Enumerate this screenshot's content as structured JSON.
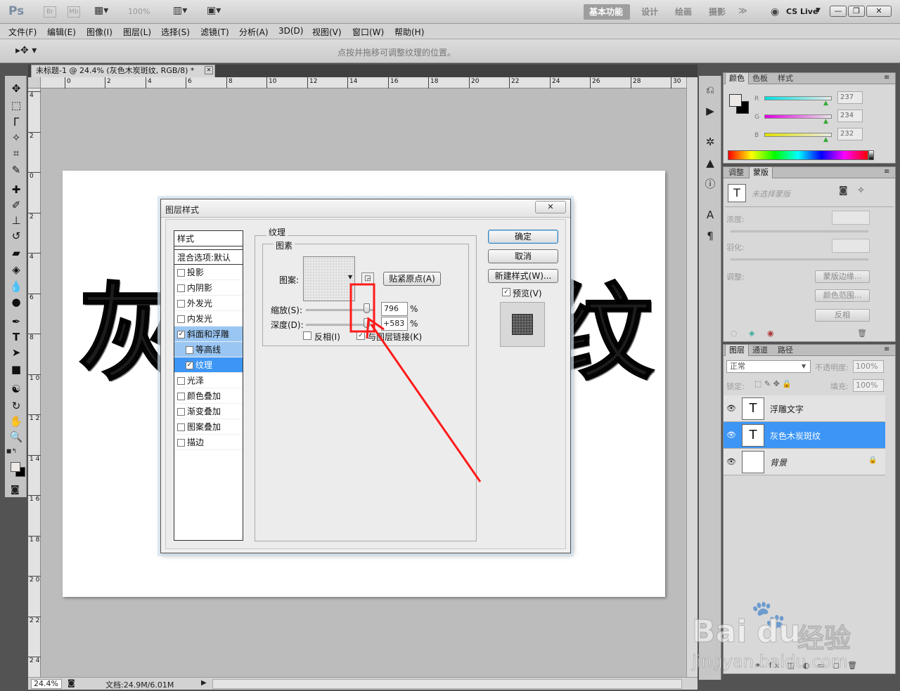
{
  "app": {
    "logo": "Ps",
    "mini_br": "Br",
    "mini_mb": "Mb",
    "zoom": "100%",
    "workspaces": [
      "基本功能",
      "设计",
      "绘画",
      "摄影"
    ],
    "more": "≫",
    "cslive": "CS Live",
    "win_min": "—",
    "win_max": "❐",
    "win_close": "✕"
  },
  "menu": [
    "文件(F)",
    "编辑(E)",
    "图像(I)",
    "图层(L)",
    "选择(S)",
    "滤镜(T)",
    "分析(A)",
    "3D(D)",
    "视图(V)",
    "窗口(W)",
    "帮助(H)"
  ],
  "options_hint": "点按并拖移可调整纹理的位置。",
  "document": {
    "tab_title": "未标题-1 @ 24.4% (灰色木炭斑纹, RGB/8) *",
    "tab_close": "✕",
    "canvas_char_left": "灰",
    "canvas_char_right": "纹",
    "ruler_top": [
      "0",
      "2",
      "4",
      "6",
      "8",
      "10",
      "12",
      "14",
      "16",
      "18",
      "20",
      "22",
      "24",
      "26",
      "28",
      "30"
    ],
    "ruler_left": [
      "4",
      "2",
      "0",
      "2",
      "4",
      "6",
      "8",
      "1 0",
      "1 2",
      "1 4",
      "1 6",
      "1 8",
      "2 0",
      "2 2",
      "2 4"
    ]
  },
  "status": {
    "zoom": "24.4%",
    "doc": "文档:24.9M/6.01M"
  },
  "color_panel": {
    "tabs": [
      "颜色",
      "色板",
      "样式"
    ],
    "r_label": "R",
    "g_label": "G",
    "b_label": "B",
    "r": 237,
    "g": 234,
    "b": 232
  },
  "masks_panel": {
    "tabs": [
      "调整",
      "蒙版"
    ],
    "no_mask": "未选择蒙版",
    "density": "浓度:",
    "feather": "羽化:",
    "refine": "调整:",
    "btn_edge": "蒙版边缘...",
    "btn_range": "颜色范围...",
    "btn_invert": "反相"
  },
  "layers_panel": {
    "tabs": [
      "图层",
      "通道",
      "路径"
    ],
    "blend": "正常",
    "opacity_label": "不透明度:",
    "opacity": "100%",
    "lock_label": "锁定:",
    "fill_label": "填充:",
    "fill": "100%",
    "layers": [
      {
        "name": "浮雕文字",
        "thumb": "T",
        "selected": false
      },
      {
        "name": "灰色木炭斑纹",
        "thumb": "T",
        "selected": true
      },
      {
        "name": "背景",
        "thumb": "",
        "selected": false
      }
    ],
    "footer_icons": "⚭ fx ◫ ◐ ▭ ◻ 🗑"
  },
  "dialog": {
    "title": "图层样式",
    "close": "✕",
    "styles_header": "样式",
    "blend_options": "混合选项:默认",
    "items": [
      {
        "label": "投影",
        "checked": false
      },
      {
        "label": "内阴影",
        "checked": false
      },
      {
        "label": "外发光",
        "checked": false
      },
      {
        "label": "内发光",
        "checked": false
      },
      {
        "label": "斜面和浮雕",
        "checked": true
      },
      {
        "label": "等高线",
        "checked": false
      },
      {
        "label": "纹理",
        "checked": true
      },
      {
        "label": "光泽",
        "checked": false
      },
      {
        "label": "颜色叠加",
        "checked": false
      },
      {
        "label": "渐变叠加",
        "checked": false
      },
      {
        "label": "图案叠加",
        "checked": false
      },
      {
        "label": "描边",
        "checked": false
      }
    ],
    "section_title": "纹理",
    "group_title": "图素",
    "pattern_label": "图案:",
    "snap_origin": "贴紧原点(A)",
    "scale_label": "缩放(S):",
    "scale_value": "796",
    "depth_label": "深度(D):",
    "depth_value": "+583",
    "percent": "%",
    "invert": "反相(I)",
    "link": "与图层链接(K)",
    "ok": "确定",
    "cancel": "取消",
    "new_style": "新建样式(W)...",
    "preview": "预览(V)"
  },
  "watermark": {
    "brand": "Bai",
    "brand2": "du",
    "brand3": "经验",
    "url": "jingyan.baidu.com"
  },
  "colors": {
    "accent": "#3d96f5",
    "annotation": "#ff1a1a"
  }
}
